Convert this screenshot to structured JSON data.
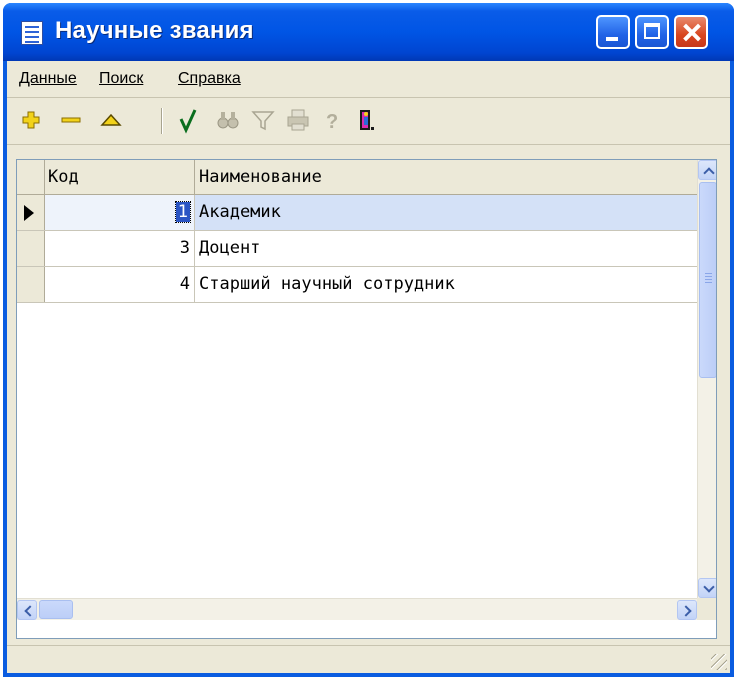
{
  "window": {
    "title": "Научные звания"
  },
  "menu": {
    "items": [
      "Данные",
      "Поиск",
      "Справка"
    ]
  },
  "toolbar": {
    "buttons": [
      "add-icon",
      "delete-icon",
      "edit-icon",
      "post-icon",
      "find-icon",
      "filter-icon",
      "print-icon",
      "help-icon",
      "exit-icon"
    ]
  },
  "grid": {
    "columns": [
      "Код",
      "Наименование"
    ],
    "rows": [
      {
        "code": "1",
        "name": "Академик",
        "selected": true
      },
      {
        "code": "3",
        "name": "Доцент",
        "selected": false
      },
      {
        "code": "4",
        "name": "Старший научный сотрудник",
        "selected": false
      }
    ]
  },
  "status": {
    "text": ""
  },
  "colors": {
    "titlebar": "#0055e5",
    "selection": "#d4e1f7",
    "face": "#ece9d8"
  }
}
